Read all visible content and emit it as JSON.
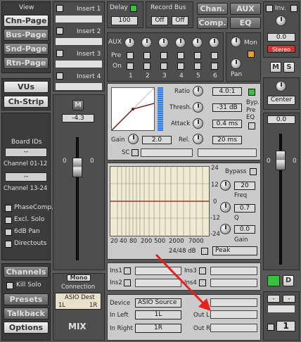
{
  "view": {
    "label": "View",
    "buttons": [
      "Chn-Page",
      "Bus-Page",
      "Snd-Page",
      "Rtn-Page"
    ],
    "active": "Chn-Page"
  },
  "vus": {
    "vus": "VUs",
    "chstrip": "Ch-Strip"
  },
  "board": {
    "title": "Board IDs",
    "id1": "--",
    "ch1": "Channel 01-12",
    "id2": "--",
    "ch2": "Channel 13-24"
  },
  "options": {
    "phase": "PhaseComp.",
    "excl": "Excl. Solo",
    "pan": "6dB Pan",
    "direct": "Directouts"
  },
  "bottom_left": {
    "channels": "Channels",
    "kill": "Kill Solo",
    "presets": "Presets",
    "talkback": "Talkback",
    "options": "Options"
  },
  "inserts": [
    "Insert 1",
    "Insert 2",
    "Insert 3",
    "Insert 4"
  ],
  "strip": {
    "m": "M",
    "gain_value": "-4.3",
    "scale_0": "0",
    "mono": "Mono",
    "connection": "Connection",
    "asio": "ASIO Dest",
    "l": "1L",
    "r": "1R",
    "mix": "MIX"
  },
  "delay": {
    "label": "Delay",
    "value": "100"
  },
  "recbus": {
    "label": "Record Bus",
    "l": "Off",
    "r": "Off"
  },
  "mode_buttons": [
    "Chan.",
    "AUX",
    "Comp.",
    "EQ"
  ],
  "aux": {
    "label": "AUX",
    "pre": "Pre",
    "on": "On",
    "numbers": [
      "1",
      "2",
      "3",
      "4",
      "5",
      "6"
    ]
  },
  "mon": {
    "mon": "Mon",
    "pan": "Pan"
  },
  "comp": {
    "ratio_label": "Ratio",
    "ratio": "4.0:1",
    "thresh_label": "Thresh.",
    "thresh": "-31 dB",
    "attack_label": "Attack",
    "attack": "0.4 ms",
    "rel_label": "Rel.",
    "rel": "20 ms",
    "gain_label": "Gain",
    "gain": "2.0",
    "byp": "Byp.",
    "pre_eq": "Pre\nEQ",
    "sc": "SC"
  },
  "eq": {
    "y_top": "24",
    "y_12": "12",
    "y_0": "0",
    "y_m12": "-12",
    "y_m24": "-24",
    "x_labels": [
      "20",
      "40",
      "80",
      "200",
      "500",
      "2000",
      "7000"
    ],
    "bypass": "Bypass",
    "freq_value": "20",
    "freq_label": "Freq",
    "q_value": "0.7",
    "q_label": "Q",
    "gain_value": "0.0",
    "gain_label": "Gain",
    "slope": "24/48 dB",
    "type": "Peak"
  },
  "ins": {
    "ins1": "Ins1",
    "ins2": "Ins2",
    "ins3": "Ins3",
    "ins4": "Ins4"
  },
  "device": {
    "device_label": "Device",
    "device": "ASIO Source",
    "in_left_label": "In Left",
    "in_left": "1L",
    "in_right_label": "In Right",
    "in_right": "1R",
    "out_l": "Out L",
    "out_r": "Out R"
  },
  "right": {
    "inv": "Inv.",
    "pan_value": "0.0",
    "stereo": "Stereo",
    "m": "M",
    "s": "S",
    "center": "Center",
    "fader_value": "0.0",
    "scale_0": "0",
    "d": "D",
    "minus1": "-",
    "minus2": "-",
    "channel": "1"
  },
  "colors": {
    "accent_green": "#36c23a",
    "arrow_red": "#e8201e",
    "stereo_red": "#d83030"
  }
}
